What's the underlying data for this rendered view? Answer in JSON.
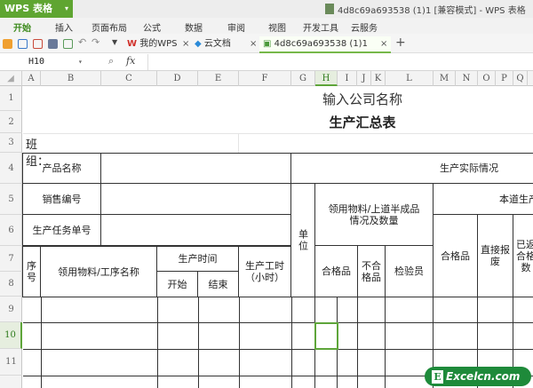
{
  "app": {
    "name": "WPS 表格",
    "window_title": "4d8c69a693538 (1)1 [兼容模式] - WPS 表格"
  },
  "menu": [
    "开始",
    "插入",
    "页面布局",
    "公式",
    "数据",
    "审阅",
    "视图",
    "开发工具",
    "云服务"
  ],
  "tabs": [
    {
      "label": "我的WPS"
    },
    {
      "label": "云文档"
    },
    {
      "label": "4d8c69a693538 (1)1"
    }
  ],
  "formula_bar": {
    "name_box": "H10",
    "fx": "fx",
    "value": ""
  },
  "columns": [
    "A",
    "B",
    "C",
    "D",
    "E",
    "F",
    "G",
    "H",
    "I",
    "J",
    "K",
    "L",
    "M",
    "N",
    "O",
    "P",
    "Q"
  ],
  "rows": [
    "1",
    "2",
    "3",
    "4",
    "5",
    "6",
    "7",
    "8",
    "9",
    "10",
    "11"
  ],
  "sheet": {
    "company": "输入公司名称",
    "title": "生产汇总表",
    "team": "班组：",
    "product_name": "产品名称",
    "sales_no": "销售编号",
    "task_no": "生产任务单号",
    "actual": "生产实际情况",
    "unit": "单位",
    "material_info": "领用物料/上道半成品情况及数量",
    "this_process": "本道生产",
    "seq": "序号",
    "material_proc": "领用物料/工序名称",
    "prod_time": "生产时间",
    "start": "开始",
    "end": "结束",
    "work_hours": "生产工时（小时）",
    "qualified": "合格品",
    "unqualified": "不合格品",
    "inspector": "检验员",
    "qualified2": "合格品",
    "scrap": "直接报废",
    "returned": "已返合格数"
  },
  "watermark": "Excelcn.com",
  "colors": {
    "accent": "#5fa531"
  }
}
